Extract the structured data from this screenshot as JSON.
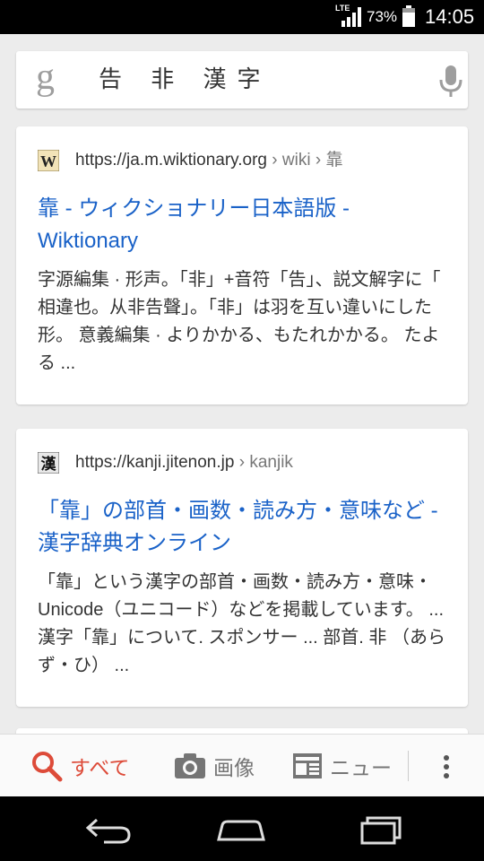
{
  "status_bar": {
    "network": "LTE",
    "battery_percent": "73%",
    "time": "14:05",
    "icons": [
      "signal-icon",
      "battery-icon"
    ]
  },
  "search": {
    "logo": "g",
    "query": "告 非 漢字",
    "icons": [
      "google-g-icon",
      "mic-icon"
    ]
  },
  "results": [
    {
      "favicon": "wikipedia-w-icon",
      "url": "https://ja.m.wiktionary.org",
      "breadcrumb": " › wiki › 靠",
      "title": "靠 - ウィクショナリー日本語版 - Wiktionary",
      "snippet": "字源編集 · 形声。「非」+音符「告」、説文解字に「 相違也。从非告聲」。「非」は羽を互い違いにした形。 意義編集 · よりかかる、もたれかかる。 たよる ..."
    },
    {
      "favicon": "kanji-favicon-icon",
      "favicon_text": "漢",
      "url": "https://kanji.jitenon.jp",
      "breadcrumb": " › kanjik",
      "title": "「靠」の部首・画数・読み方・意味など - 漢字辞典オンライン",
      "snippet": "「靠」という漢字の部首・画数・読み方・意味・ Unicode（ユニコード）などを掲載しています。 ... 漢字「靠」について. スポンサー ... 部首. 非 （あらず・ひ） ..."
    }
  ],
  "tabs": {
    "all": "すべて",
    "images": "画像",
    "news": "ニュー"
  },
  "colors": {
    "link": "#1a62c8",
    "active_tab": "#dd4b39",
    "inactive_tab": "#757575"
  }
}
